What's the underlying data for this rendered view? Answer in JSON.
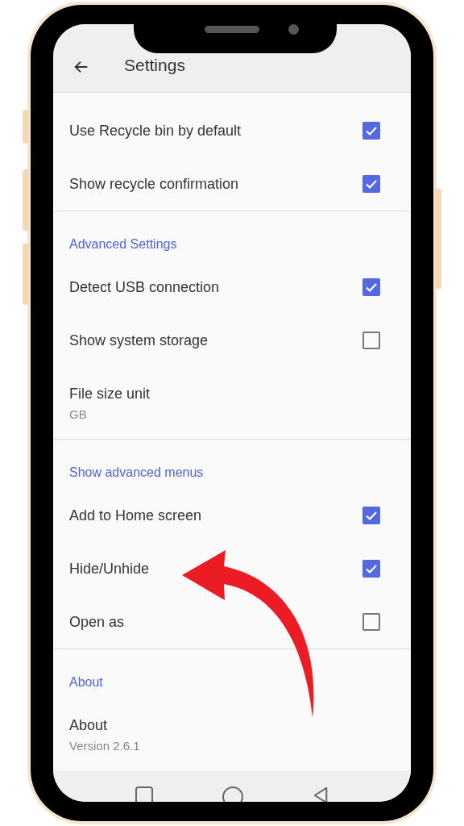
{
  "app_bar": {
    "title": "Settings"
  },
  "sections": [
    {
      "items": [
        {
          "kind": "checkbox",
          "label": "Use Recycle bin by default",
          "checked": true
        },
        {
          "kind": "checkbox",
          "label": "Show recycle confirmation",
          "checked": true
        }
      ]
    },
    {
      "header": "Advanced Settings",
      "items": [
        {
          "kind": "checkbox",
          "label": "Detect USB connection",
          "checked": true
        },
        {
          "kind": "checkbox",
          "label": "Show system storage",
          "checked": false
        },
        {
          "kind": "value",
          "label": "File size unit",
          "summary": "GB"
        }
      ]
    },
    {
      "header": "Show advanced menus",
      "items": [
        {
          "kind": "checkbox",
          "label": "Add to Home screen",
          "checked": true
        },
        {
          "kind": "checkbox",
          "label": "Hide/Unhide",
          "checked": true
        },
        {
          "kind": "checkbox",
          "label": "Open as",
          "checked": false
        }
      ]
    },
    {
      "header": "About",
      "items": [
        {
          "kind": "value",
          "label": "About",
          "summary": "Version 2.6.1"
        }
      ]
    }
  ]
}
